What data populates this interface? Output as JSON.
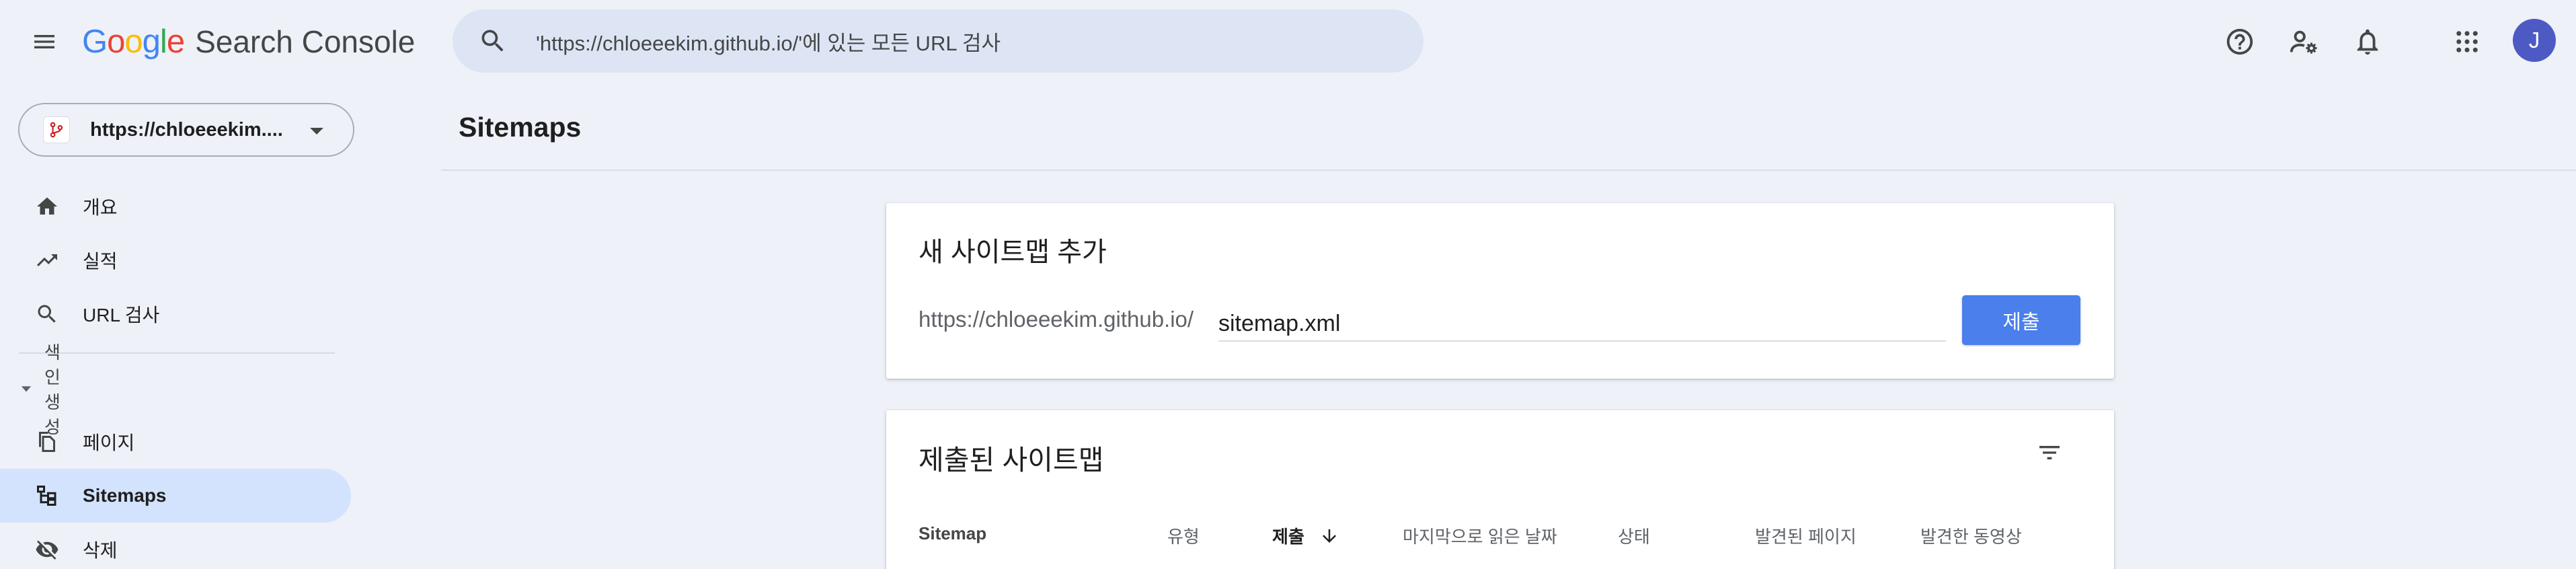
{
  "header": {
    "logo_google": "Google",
    "logo_product": "Search Console",
    "search_placeholder": "'https://chloeeekim.github.io/'에 있는 모든 URL 검사",
    "user_initial": "J",
    "icons": [
      "menu-icon",
      "search-icon",
      "help-icon",
      "manage-users-icon",
      "notifications-icon",
      "apps-grid-icon"
    ]
  },
  "sidebar": {
    "property_label": "https://chloeeekim....",
    "items": [
      {
        "label": "개요",
        "icon": "home-icon"
      },
      {
        "label": "실적",
        "icon": "trending-up-icon"
      },
      {
        "label": "URL 검사",
        "icon": "search-icon"
      }
    ],
    "section_label": "색인생성",
    "index_items": [
      {
        "label": "페이지",
        "icon": "pages-icon"
      },
      {
        "label": "Sitemaps",
        "icon": "sitemap-icon",
        "selected": true
      },
      {
        "label": "삭제",
        "icon": "visibility-off-icon"
      }
    ]
  },
  "main": {
    "page_title": "Sitemaps",
    "add_sitemap": {
      "title": "새 사이트맵 추가",
      "url_prefix": "https://chloeeekim.github.io/",
      "input_value": "sitemap.xml",
      "submit_label": "제출"
    },
    "submitted_sitemaps": {
      "title": "제출된 사이트맵",
      "columns": [
        "Sitemap",
        "유형",
        "제출",
        "마지막으로 읽은 날짜",
        "상태",
        "발견된 페이지",
        "발견한 동영상"
      ],
      "sorted_column": "제출",
      "sort_direction": "descending"
    }
  },
  "colors": {
    "background": "#eef1f8",
    "search_bg": "#dde5f5",
    "selected_nav": "#d3e3fd",
    "primary_button": "#4a7fec",
    "avatar": "#4d5ac4"
  }
}
